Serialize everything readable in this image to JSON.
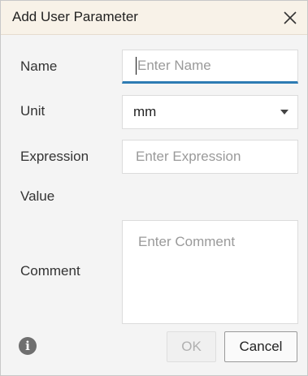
{
  "dialog": {
    "title": "Add User Parameter",
    "close_icon": "close-icon",
    "info_icon": "info-icon",
    "info_glyph": "i"
  },
  "form": {
    "name": {
      "label": "Name",
      "placeholder": "Enter Name",
      "value": ""
    },
    "unit": {
      "label": "Unit",
      "value": "mm"
    },
    "expression": {
      "label": "Expression",
      "placeholder": "Enter Expression",
      "value": ""
    },
    "value": {
      "label": "Value",
      "value": ""
    },
    "comment": {
      "label": "Comment",
      "placeholder": "Enter Comment",
      "value": ""
    }
  },
  "buttons": {
    "ok": "OK",
    "cancel": "Cancel"
  },
  "colors": {
    "titlebar_bg": "#f8f2e8",
    "focus_accent": "#2d7bb3",
    "disabled_text": "#b0b0b0"
  }
}
